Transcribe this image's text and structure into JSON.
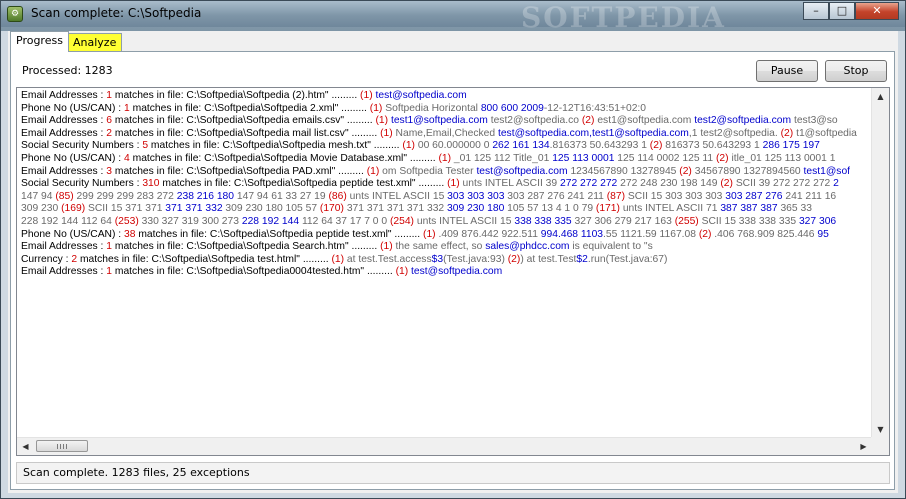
{
  "window": {
    "title": "Scan complete: C:\\Softpedia",
    "watermark": "SOFTPEDIA",
    "minimize": "–",
    "maximize": "□",
    "close": "✕"
  },
  "tabs": [
    {
      "label": "Progress",
      "active": true
    },
    {
      "label": "Analyze",
      "active": false,
      "highlight": "#ffff33"
    }
  ],
  "progress": {
    "processed": "Processed: 1283",
    "pause_label": "Pause",
    "stop_label": "Stop"
  },
  "results": [
    [
      [
        "k",
        "Email Addresses : "
      ],
      [
        "r",
        "1"
      ],
      [
        "k",
        " matches in file: C:\\Softpedia\\Softpedia (2).htm\" .........  "
      ],
      [
        "r",
        "(1)"
      ],
      [
        "g",
        "                     "
      ],
      [
        "b",
        "test@softpedia.com"
      ]
    ],
    [
      [
        "k",
        "Phone No (US/CAN) : "
      ],
      [
        "r",
        "1"
      ],
      [
        "k",
        " matches in file: C:\\Softpedia\\Softpedia 2.xml\" .........  "
      ],
      [
        "r",
        "(1)"
      ],
      [
        "g",
        " Softpedia Horizontal "
      ],
      [
        "b",
        "800 600 2009"
      ],
      [
        "g",
        "-12-12T16:43:51+02:0"
      ]
    ],
    [
      [
        "k",
        "Email Addresses : "
      ],
      [
        "r",
        "6"
      ],
      [
        "k",
        " matches in file: C:\\Softpedia\\Softpedia emails.csv\" .........  "
      ],
      [
        "r",
        "(1)"
      ],
      [
        "b",
        " test1@softpedia.com"
      ],
      [
        "g",
        "  test2@softpedia.co "
      ],
      [
        "r",
        "(2)"
      ],
      [
        "g",
        " est1@softpedia.com   "
      ],
      [
        "b",
        "test2@softpedia.com"
      ],
      [
        "g",
        "  test3@so"
      ]
    ],
    [
      [
        "k",
        "Email Addresses : "
      ],
      [
        "r",
        "2"
      ],
      [
        "k",
        " matches in file: C:\\Softpedia\\Softpedia mail list.csv\" .........  "
      ],
      [
        "r",
        "(1)"
      ],
      [
        "g",
        " Name,Email,Checked  "
      ],
      [
        "b",
        "test@softpedia.com,test1@softpedia.com"
      ],
      [
        "g",
        ",1  test2@softpedia. "
      ],
      [
        "r",
        "(2)"
      ],
      [
        "g",
        " t1@softpedia"
      ]
    ],
    [
      [
        "k",
        "Social Security Numbers : "
      ],
      [
        "r",
        "5"
      ],
      [
        "k",
        " matches in file: C:\\Softpedia\\Softpedia mesh.txt\" .........  "
      ],
      [
        "r",
        "(1)"
      ],
      [
        "g",
        " 00 60.000000       0 "
      ],
      [
        "b",
        "262 161 134"
      ],
      [
        "g",
        ".816373 50.643293  1 "
      ],
      [
        "r",
        "(2)"
      ],
      [
        "g",
        " 816373 50.643293  1 "
      ],
      [
        "b",
        "286 175 197"
      ]
    ],
    [
      [
        "k",
        "Phone No (US/CAN) : "
      ],
      [
        "r",
        "4"
      ],
      [
        "k",
        " matches in file: C:\\Softpedia\\Softpedia Movie Database.xml\" .........  "
      ],
      [
        "r",
        "(1)"
      ],
      [
        "g",
        " _01 125 112 Title_01 "
      ],
      [
        "b",
        "125 113 0001"
      ],
      [
        "g",
        " 125 114 0002 125 11 "
      ],
      [
        "r",
        "(2)"
      ],
      [
        "g",
        " itle_01 125 113 0001 1"
      ]
    ],
    [
      [
        "k",
        "Email Addresses : "
      ],
      [
        "r",
        "3"
      ],
      [
        "k",
        " matches in file: C:\\Softpedia\\Softpedia PAD.xml\" .........  "
      ],
      [
        "r",
        "(1)"
      ],
      [
        "g",
        " om Softpedia Tester "
      ],
      [
        "b",
        "test@softpedia.com"
      ],
      [
        "g",
        " 1234567890 13278945 "
      ],
      [
        "r",
        "(2)"
      ],
      [
        "g",
        " 34567890 1327894560 "
      ],
      [
        "b",
        "test1@sof"
      ]
    ],
    [
      [
        "k",
        "Social Security Numbers : "
      ],
      [
        "r",
        "310"
      ],
      [
        "k",
        " matches in file: C:\\Softpedia\\Softpedia peptide test.xml\" .........  "
      ],
      [
        "r",
        "(1)"
      ],
      [
        "g",
        " unts INTEL ASCII 39 "
      ],
      [
        "b",
        "272 272 272"
      ],
      [
        "g",
        " 272 248 230 198 149 "
      ],
      [
        "r",
        "(2)"
      ],
      [
        "g",
        " SCII 39 272 272 272 "
      ],
      [
        "b",
        "2"
      ]
    ],
    [
      [
        "g",
        "147 94 "
      ],
      [
        "r",
        "(85)"
      ],
      [
        "g",
        " 299 299 299 283 272 "
      ],
      [
        "b",
        "238 216 180"
      ],
      [
        "g",
        " 147 94 61 33 27 19 "
      ],
      [
        "r",
        "(86)"
      ],
      [
        "g",
        " unts INTEL ASCII 15 "
      ],
      [
        "b",
        "303 303 303"
      ],
      [
        "g",
        " 303 287 276 241 211 "
      ],
      [
        "r",
        "(87)"
      ],
      [
        "g",
        " SCII 15 303 303 303 "
      ],
      [
        "b",
        "303 287 276"
      ],
      [
        "g",
        " 241 211 16"
      ]
    ],
    [
      [
        "g",
        "309 230 "
      ],
      [
        "r",
        "(169)"
      ],
      [
        "g",
        " SCII 15 371 371 "
      ],
      [
        "b",
        "371 371 332"
      ],
      [
        "g",
        " 309 230 180 105 57 "
      ],
      [
        "r",
        "(170)"
      ],
      [
        "g",
        " 371 371 371 371 332 "
      ],
      [
        "b",
        "309 230 180"
      ],
      [
        "g",
        " 105 57 13 4 1 0  79 "
      ],
      [
        "r",
        "(171)"
      ],
      [
        "g",
        " unts INTEL ASCII 71 "
      ],
      [
        "b",
        "387 387 387"
      ],
      [
        "g",
        " 365 33"
      ]
    ],
    [
      [
        "g",
        "228 192 144 112 64 "
      ],
      [
        "r",
        "(253)"
      ],
      [
        "g",
        " 330 327 319 300 273 "
      ],
      [
        "b",
        "228 192 144"
      ],
      [
        "g",
        " 112 64 37 17 7 0 0 "
      ],
      [
        "r",
        "(254)"
      ],
      [
        "g",
        " unts INTEL ASCII 15 "
      ],
      [
        "b",
        "338 338 335"
      ],
      [
        "g",
        " 327 306 279 217 163 "
      ],
      [
        "r",
        "(255)"
      ],
      [
        "g",
        " SCII 15 338 338 335 "
      ],
      [
        "b",
        "327 306"
      ]
    ],
    [
      [
        "k",
        "Phone No (US/CAN) : "
      ],
      [
        "r",
        "38"
      ],
      [
        "k",
        " matches in file: C:\\Softpedia\\Softpedia peptide test.xml\" .........  "
      ],
      [
        "r",
        "(1)"
      ],
      [
        "g",
        " .409 876.442 922.511 "
      ],
      [
        "b",
        "994.468 1103"
      ],
      [
        "g",
        ".55 1121.59 1167.08  "
      ],
      [
        "r",
        "(2)"
      ],
      [
        "g",
        " .406 768.909 825.446 "
      ],
      [
        "b",
        "95"
      ]
    ],
    [
      [
        "k",
        "Email Addresses : "
      ],
      [
        "r",
        "1"
      ],
      [
        "k",
        " matches in file: C:\\Softpedia\\Softpedia Search.htm\" .........  "
      ],
      [
        "r",
        "(1)"
      ],
      [
        "g",
        " the same effect, so "
      ],
      [
        "b",
        "sales@phdcc.com"
      ],
      [
        "g",
        " is equivalent to \"s"
      ]
    ],
    [
      [
        "k",
        "Currency : "
      ],
      [
        "r",
        "2"
      ],
      [
        "k",
        " matches in file: C:\\Softpedia\\Softpedia test.html\" .........  "
      ],
      [
        "r",
        "(1)"
      ],
      [
        "g",
        "  at test.Test.access"
      ],
      [
        "b",
        "$3"
      ],
      [
        "g",
        "(Test.java:93)       "
      ],
      [
        "r",
        "(2)"
      ],
      [
        "g",
        ")       at test.Test"
      ],
      [
        "b",
        "$2"
      ],
      [
        "g",
        ".run(Test.java:67)"
      ]
    ],
    [
      [
        "k",
        "Email Addresses : "
      ],
      [
        "r",
        "1"
      ],
      [
        "k",
        " matches in file: C:\\Softpedia\\Softpedia0004tested.htm\" .........  "
      ],
      [
        "r",
        "(1)"
      ],
      [
        "g",
        "                     "
      ],
      [
        "b",
        "test@softpedia.com"
      ]
    ]
  ],
  "status": "Scan complete. 1283 files, 25 exceptions"
}
